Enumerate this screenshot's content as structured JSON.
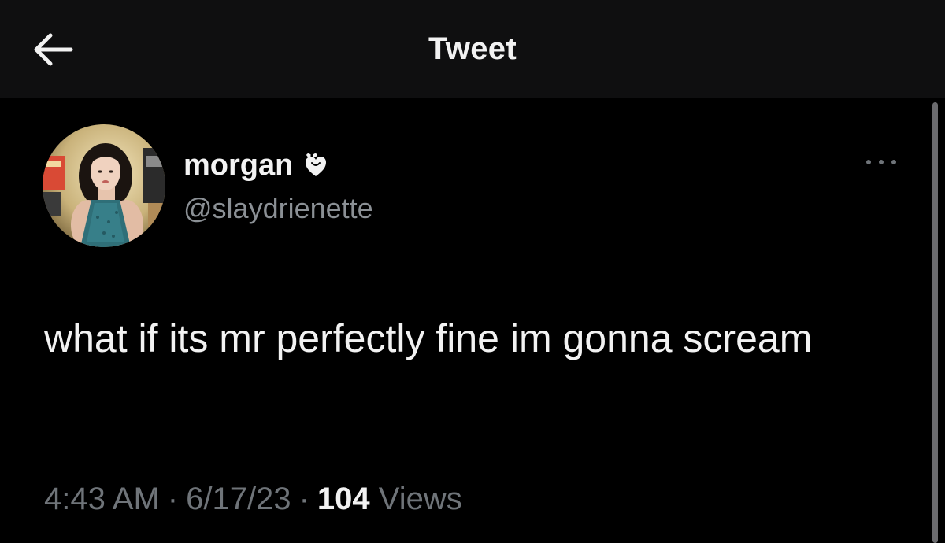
{
  "header": {
    "title": "Tweet",
    "back_icon": "arrow-left-icon"
  },
  "author": {
    "display_name": "morgan",
    "name_emoji": "heart-with-bow-emoji",
    "handle": "@slaydrienette",
    "avatar": "profile-photo"
  },
  "tweet": {
    "text": "what if its mr perfectly fine im gonna scream",
    "time": "4:43 AM",
    "date": "6/17/23",
    "separator": "·",
    "views_count": "104",
    "views_label": "Views"
  },
  "menu": {
    "more_icon": "more-dots-icon"
  },
  "colors": {
    "background": "#000000",
    "header_background": "#0f0f10",
    "primary_text": "#f2f2f2",
    "secondary_text": "#8b9095",
    "meta_text": "#6f7479"
  }
}
